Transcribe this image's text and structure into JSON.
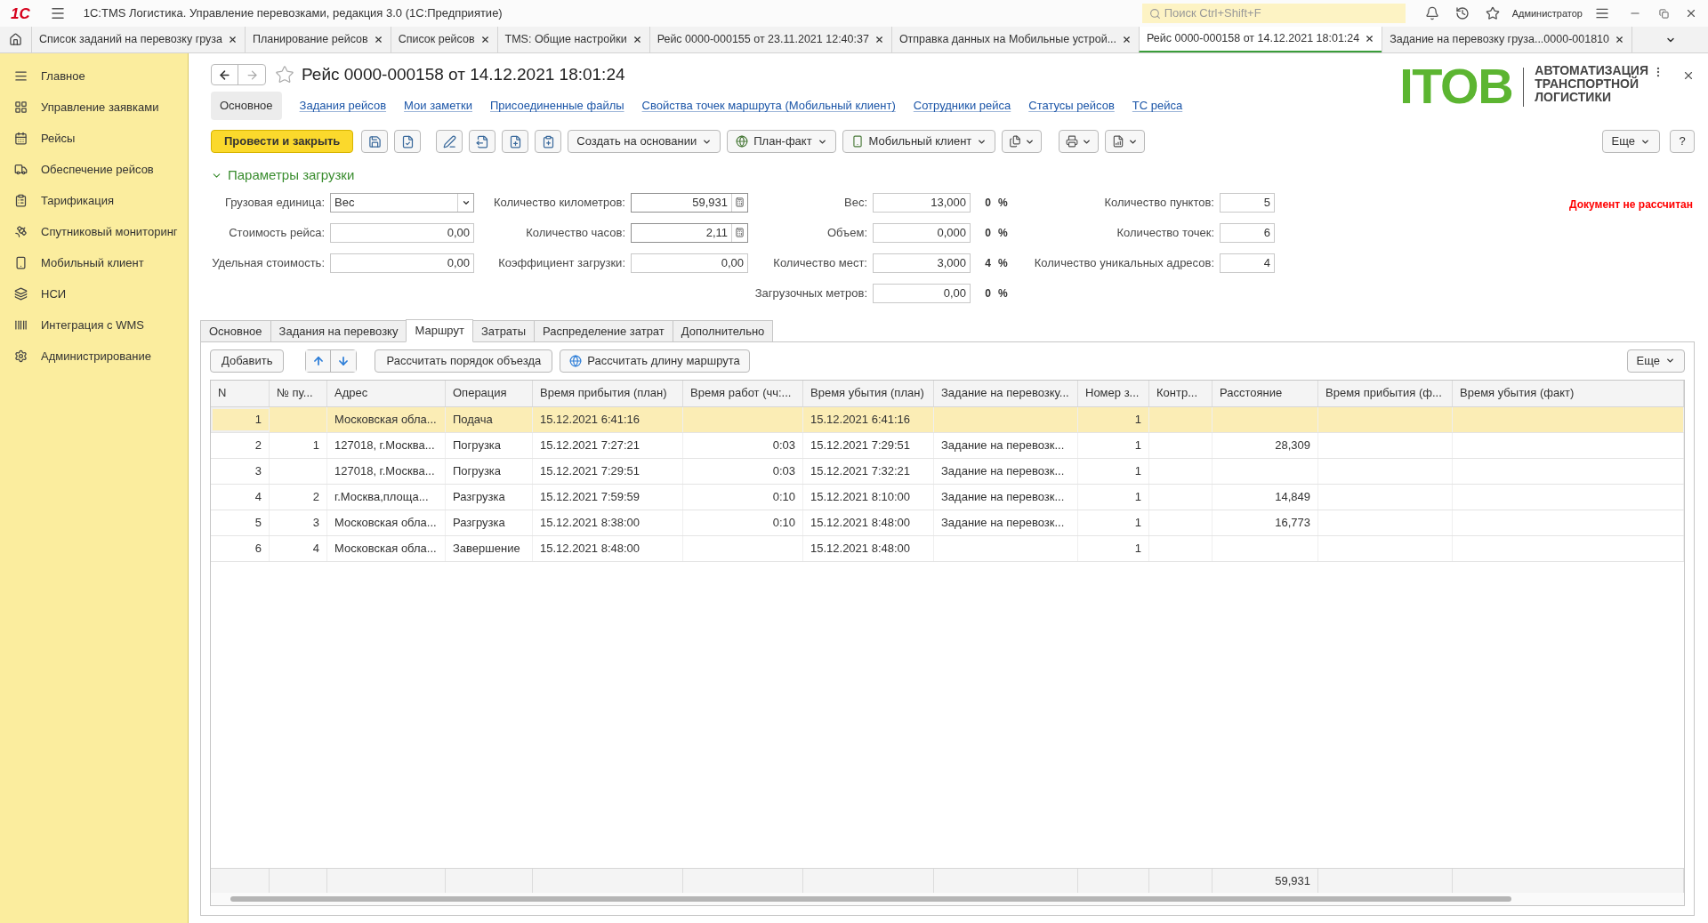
{
  "window": {
    "logo": "1С",
    "title": "1С:TMS Логистика. Управление перевозками, редакция 3.0  (1С:Предприятие)",
    "search_placeholder": "Поиск Ctrl+Shift+F",
    "user": "Администратор"
  },
  "open_tabs": [
    {
      "label": "Список заданий на перевозку груза",
      "selected": false
    },
    {
      "label": "Планирование рейсов",
      "selected": false
    },
    {
      "label": "Список рейсов",
      "selected": false
    },
    {
      "label": "TMS: Общие настройки",
      "selected": false
    },
    {
      "label": "Рейс 0000-000155 от 23.11.2021 12:40:37",
      "selected": false
    },
    {
      "label": "Отправка данных на Мобильные устрой...",
      "selected": false
    },
    {
      "label": "Рейс 0000-000158 от 14.12.2021 18:01:24",
      "selected": true
    },
    {
      "label": "Задание на перевозку груза...0000-001810",
      "selected": false
    }
  ],
  "sidebar": {
    "items": [
      {
        "label": "Главное"
      },
      {
        "label": "Управление заявками"
      },
      {
        "label": "Рейсы"
      },
      {
        "label": "Обеспечение рейсов"
      },
      {
        "label": "Тарификация"
      },
      {
        "label": "Спутниковый мониторинг"
      },
      {
        "label": "Мобильный клиент"
      },
      {
        "label": "НСИ"
      },
      {
        "label": "Интеграция с WMS"
      },
      {
        "label": "Администрирование"
      }
    ]
  },
  "form": {
    "title": "Рейс 0000-000158 от 14.12.2021 18:01:24",
    "favorite": false,
    "logo": {
      "mark": "ITOB",
      "lines": [
        "АВТОМАТИЗАЦИЯ",
        "ТРАНСПОРТНОЙ",
        "ЛОГИСТИКИ"
      ]
    },
    "nav_links": [
      {
        "label": "Основное",
        "selected": true
      },
      {
        "label": "Задания рейсов",
        "selected": false
      },
      {
        "label": "Мои заметки",
        "selected": false
      },
      {
        "label": "Присоединенные файлы",
        "selected": false
      },
      {
        "label": "Свойства точек маршрута (Мобильный клиент)",
        "selected": false
      },
      {
        "label": "Сотрудники рейса",
        "selected": false
      },
      {
        "label": "Статусы рейсов",
        "selected": false
      },
      {
        "label": "ТС рейса",
        "selected": false
      }
    ],
    "toolbar": [
      {
        "kind": "primary",
        "label": "Провести и закрыть"
      },
      {
        "kind": "icon"
      },
      {
        "kind": "icon"
      },
      {
        "kind": "icon"
      },
      {
        "kind": "icon"
      },
      {
        "kind": "icon"
      },
      {
        "kind": "icon"
      },
      {
        "kind": "menu",
        "label": "Создать на основании"
      },
      {
        "kind": "menu",
        "label": "План-факт"
      },
      {
        "kind": "menu",
        "label": "Мобильный клиент"
      },
      {
        "kind": "icon-menu"
      },
      {
        "kind": "icon-menu"
      },
      {
        "kind": "icon-menu"
      }
    ],
    "more_button": "Еще",
    "help_button": "?",
    "params_section": {
      "title": "Параметры загрузки",
      "expanded": true
    },
    "params": [
      [
        {
          "label": "Грузовая единица:",
          "value": "Вес",
          "kind": "dropdown"
        },
        {
          "label": "Стоимость рейса:",
          "value": "0,00",
          "kind": "plain"
        },
        {
          "label": "Удельная стоимость:",
          "value": "0,00",
          "kind": "plain"
        }
      ],
      [
        {
          "label": "Количество километров:",
          "value": "59,931",
          "kind": "calc"
        },
        {
          "label": "Количество часов:",
          "value": "2,11",
          "kind": "calc"
        },
        {
          "label": "Коэффициент загрузки:",
          "value": "0,00",
          "kind": "plain"
        }
      ],
      [
        {
          "label": "Вес:",
          "value": "13,000",
          "kind": "plain",
          "percent": "0",
          "unit": "%"
        },
        {
          "label": "Объем:",
          "value": "0,000",
          "kind": "plain",
          "percent": "0",
          "unit": "%"
        },
        {
          "label": "Количество мест:",
          "value": "3,000",
          "kind": "plain",
          "percent": "4",
          "unit": "%"
        },
        {
          "label": "Загрузочных метров:",
          "value": "0,00",
          "kind": "plain",
          "percent": "0",
          "unit": "%"
        }
      ],
      [
        {
          "label": "Количество пунктов:",
          "value": "5",
          "kind": "plain"
        },
        {
          "label": "Количество точек:",
          "value": "6",
          "kind": "plain"
        },
        {
          "label": "Количество уникальных адресов:",
          "value": "4",
          "kind": "plain"
        }
      ]
    ],
    "status": "Документ не рассчитан",
    "doc_tabs": [
      {
        "label": "Основное",
        "selected": false
      },
      {
        "label": "Задания на перевозку",
        "selected": false
      },
      {
        "label": "Маршрут",
        "selected": true
      },
      {
        "label": "Затраты",
        "selected": false
      },
      {
        "label": "Распределение затрат",
        "selected": false
      },
      {
        "label": "Дополнительно",
        "selected": false
      }
    ],
    "table_toolbar": {
      "add": "Добавить",
      "order": "Рассчитать порядок объезда",
      "length": "Рассчитать длину маршрута",
      "more": "Еще"
    },
    "table": {
      "columns": [
        {
          "label": "N",
          "kind": "number"
        },
        {
          "label": "№ пу...",
          "kind": "number"
        },
        {
          "label": "Адрес",
          "kind": "text"
        },
        {
          "label": "Операция",
          "kind": "text"
        },
        {
          "label": "Время прибытия (план)",
          "kind": "text"
        },
        {
          "label": "Время работ (чч:...",
          "kind": "number"
        },
        {
          "label": "Время убытия (план)",
          "kind": "text"
        },
        {
          "label": "Задание на перевозку...",
          "kind": "text"
        },
        {
          "label": "Номер з...",
          "kind": "number"
        },
        {
          "label": "Контр...",
          "kind": "text"
        },
        {
          "label": "Расстояние",
          "kind": "number",
          "total": "59,931"
        },
        {
          "label": "Время прибытия (ф...",
          "kind": "text"
        },
        {
          "label": "Время убытия (факт)",
          "kind": "text"
        }
      ],
      "rows": [
        {
          "selected": true,
          "cells": [
            "1",
            null,
            "Московская обла...",
            "Подача",
            "15.12.2021 6:41:16",
            null,
            "15.12.2021 6:41:16",
            null,
            "1",
            null,
            null,
            null,
            null
          ]
        },
        {
          "selected": false,
          "cells": [
            "2",
            "1",
            "127018, г.Москва...",
            "Погрузка",
            "15.12.2021 7:27:21",
            "0:03",
            "15.12.2021 7:29:51",
            "Задание на перевозк...",
            "1",
            null,
            "28,309",
            null,
            null
          ]
        },
        {
          "selected": false,
          "cells": [
            "3",
            null,
            "127018, г.Москва...",
            "Погрузка",
            "15.12.2021 7:29:51",
            "0:03",
            "15.12.2021 7:32:21",
            "Задание на перевозк...",
            "1",
            null,
            null,
            null,
            null
          ]
        },
        {
          "selected": false,
          "cells": [
            "4",
            "2",
            "г.Москва,площа...",
            "Разгрузка",
            "15.12.2021 7:59:59",
            "0:10",
            "15.12.2021 8:10:00",
            "Задание на перевозк...",
            "1",
            null,
            "14,849",
            null,
            null
          ]
        },
        {
          "selected": false,
          "cells": [
            "5",
            "3",
            "Московская обла...",
            "Разгрузка",
            "15.12.2021 8:38:00",
            "0:10",
            "15.12.2021 8:48:00",
            "Задание на перевозк...",
            "1",
            null,
            "16,773",
            null,
            null
          ]
        },
        {
          "selected": false,
          "cells": [
            "6",
            "4",
            "Московская обла...",
            "Завершение",
            "15.12.2021 8:48:00",
            null,
            "15.12.2021 8:48:00",
            null,
            "1",
            null,
            null,
            null,
            null
          ]
        }
      ]
    }
  }
}
